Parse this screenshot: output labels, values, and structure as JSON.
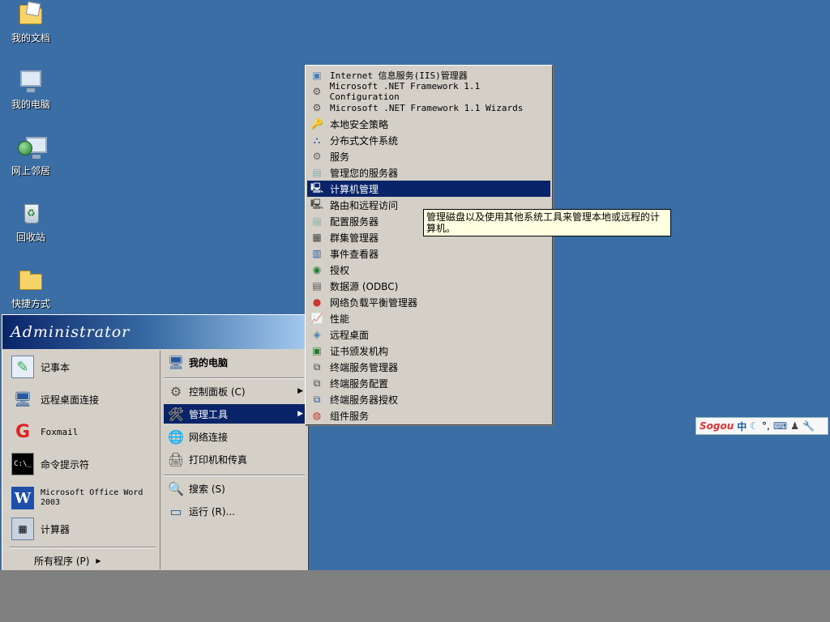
{
  "desktop": {
    "icons": [
      {
        "label": "我的文档",
        "icon": "my-documents-icon"
      },
      {
        "label": "我的电脑",
        "icon": "my-computer-icon"
      },
      {
        "label": "网上邻居",
        "icon": "network-places-icon"
      },
      {
        "label": "回收站",
        "icon": "recycle-bin-icon"
      },
      {
        "label": "快捷方式",
        "icon": "shortcut-folder-icon"
      }
    ]
  },
  "start_menu": {
    "user": "Administrator",
    "left_items": [
      {
        "label": "记事本",
        "icon": "notepad-icon"
      },
      {
        "label": "远程桌面连接",
        "icon": "remote-desktop-connection-icon"
      },
      {
        "label": "Foxmail",
        "icon": "foxmail-icon"
      },
      {
        "label": "命令提示符",
        "icon": "command-prompt-icon"
      },
      {
        "label": "Microsoft Office Word 2003",
        "icon": "word-icon"
      },
      {
        "label": "计算器",
        "icon": "calculator-icon"
      }
    ],
    "all_programs": "所有程序 (P)",
    "right_items": [
      {
        "label": "我的电脑",
        "icon": "my-computer-icon"
      },
      {
        "label": "控制面板 (C)",
        "icon": "control-panel-icon"
      },
      {
        "label": "管理工具",
        "icon": "admin-tools-icon"
      },
      {
        "label": "网络连接",
        "icon": "network-connections-icon"
      },
      {
        "label": "打印机和传真",
        "icon": "printer-icon"
      },
      {
        "label": "搜索 (S)",
        "icon": "search-icon"
      },
      {
        "label": "运行 (R)...",
        "icon": "run-icon"
      }
    ]
  },
  "admin_tools_menu": {
    "items": [
      {
        "label": "Internet 信息服务(IIS)管理器",
        "icon": "iis-icon"
      },
      {
        "label": "Microsoft .NET Framework 1.1 Configuration",
        "icon": "dotnet-config-icon"
      },
      {
        "label": "Microsoft .NET Framework 1.1 Wizards",
        "icon": "dotnet-wizards-icon"
      },
      {
        "label": "本地安全策略",
        "icon": "local-security-policy-icon"
      },
      {
        "label": "分布式文件系统",
        "icon": "dfs-icon"
      },
      {
        "label": "服务",
        "icon": "services-icon"
      },
      {
        "label": "管理您的服务器",
        "icon": "manage-server-icon"
      },
      {
        "label": "计算机管理",
        "icon": "computer-management-icon"
      },
      {
        "label": "路由和远程访问",
        "icon": "routing-remote-access-icon"
      },
      {
        "label": "配置服务器",
        "icon": "configure-server-icon"
      },
      {
        "label": "群集管理器",
        "icon": "cluster-manager-icon"
      },
      {
        "label": "事件查看器",
        "icon": "event-viewer-icon"
      },
      {
        "label": "授权",
        "icon": "licensing-icon"
      },
      {
        "label": "数据源 (ODBC)",
        "icon": "odbc-icon"
      },
      {
        "label": "网络负载平衡管理器",
        "icon": "nlb-manager-icon"
      },
      {
        "label": "性能",
        "icon": "performance-icon"
      },
      {
        "label": "远程桌面",
        "icon": "remote-desktops-icon"
      },
      {
        "label": "证书颁发机构",
        "icon": "certificate-authority-icon"
      },
      {
        "label": "终端服务管理器",
        "icon": "terminal-services-manager-icon"
      },
      {
        "label": "终端服务配置",
        "icon": "terminal-services-config-icon"
      },
      {
        "label": "终端服务器授权",
        "icon": "terminal-server-licensing-icon"
      },
      {
        "label": "组件服务",
        "icon": "component-services-icon"
      }
    ],
    "highlighted": "计算机管理"
  },
  "tooltip": "管理磁盘以及使用其他系统工具来管理本地或远程的计算机。",
  "ime_bar": {
    "brand": "Sogou",
    "mode": "中"
  },
  "colors": {
    "desktop": "#3a6ea5",
    "highlight": "#0a246a",
    "menu": "#d4d0c8",
    "tooltip": "#ffffe1"
  }
}
